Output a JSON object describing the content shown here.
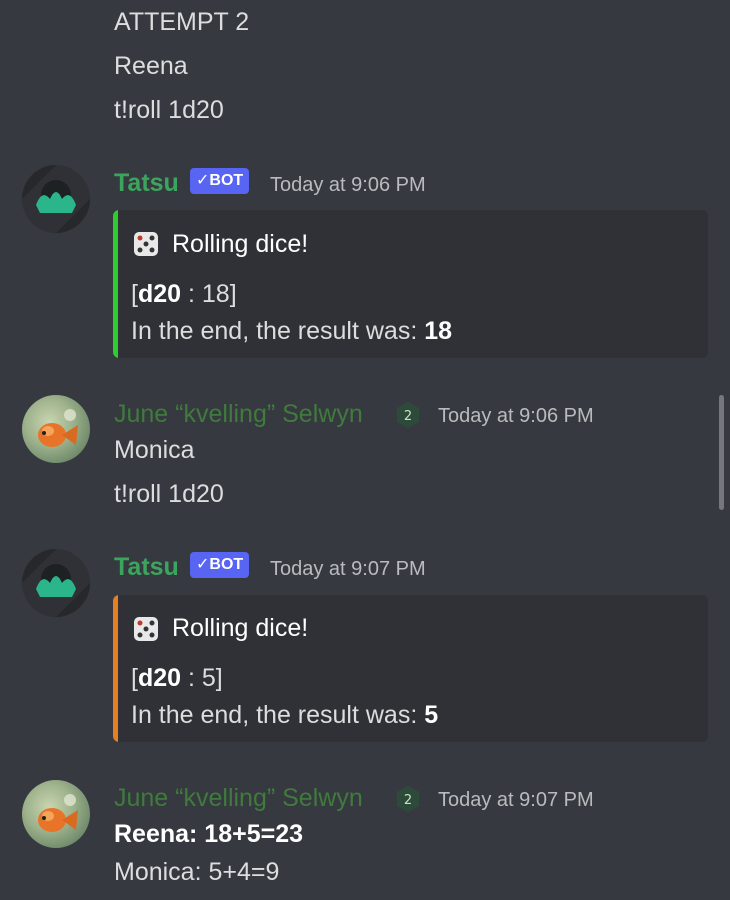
{
  "prev": {
    "line1": "ATTEMPT 2",
    "line2": "Reena",
    "line3": "t!roll 1d20"
  },
  "messages": [
    {
      "author": "Tatsu",
      "bot_tag": "✓BOT",
      "timestamp": "Today at 9:06 PM",
      "embed": {
        "title": "Rolling dice!",
        "die": "d20",
        "roll_value": " : 18]",
        "result_label": "In the end, the result was: ",
        "result": "18",
        "bar_color": "#2ecc2e"
      }
    },
    {
      "author": "June “kvelling” Selwyn",
      "timestamp": "Today at 9:06 PM",
      "role_badge": "2",
      "lines": [
        "Monica",
        "t!roll 1d20"
      ]
    },
    {
      "author": "Tatsu",
      "bot_tag": "✓BOT",
      "timestamp": "Today at 9:07 PM",
      "embed": {
        "title": "Rolling dice!",
        "die": "d20",
        "roll_value": " : 5]",
        "result_label": "In the end, the result was: ",
        "result": "5",
        "bar_color": "#e67e22"
      }
    },
    {
      "author": "June “kvelling” Selwyn",
      "timestamp": "Today at 9:07 PM",
      "role_badge": "2",
      "lines": [
        "Reena: 18+5=23",
        "Monica: 5+4=9"
      ]
    }
  ],
  "bracket_open": "[",
  "colors": {
    "background": "#36393f",
    "embed_bg": "#2f3136",
    "bot_tag": "#5865f2",
    "tatsu_name": "#3ba55d",
    "june_name": "#3f7b3c"
  },
  "icons": [
    "tatsu-avatar-icon",
    "june-avatar-icon",
    "dice-icon",
    "server-role-icon"
  ]
}
